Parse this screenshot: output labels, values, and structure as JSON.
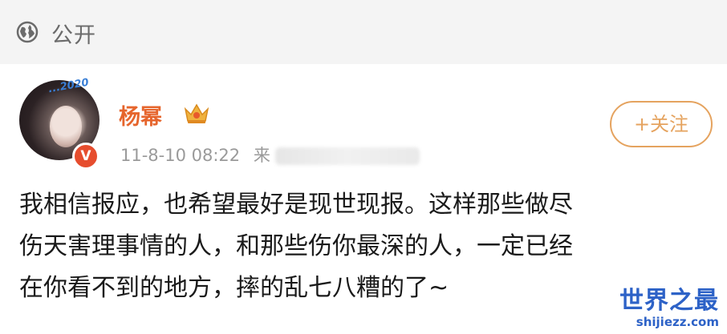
{
  "topbar": {
    "visibility_icon": "globe-icon",
    "visibility_label": "公开"
  },
  "post": {
    "author": {
      "name": "杨幂",
      "name_color": "#e6652c",
      "avatar_frame_text": "...2020",
      "verified_badge": "V",
      "crown_icon": "crown-icon"
    },
    "meta": {
      "timestamp": "11-8-10 08:22",
      "source_prefix": "来"
    },
    "follow_button_label": "+关注",
    "body": "我相信报应，也希望最好是现世现报。这样那些做尽\n伤天害理事情的人，和那些伤你最深的人，一定已经\n在你看不到的地方，摔的乱七八糟的了~"
  },
  "watermark": {
    "title": "世界之最",
    "url": "shijiezz.com",
    "color": "#2d62c7"
  },
  "colors": {
    "accent": "#e5a35f",
    "verify_red": "#e64d2e"
  }
}
